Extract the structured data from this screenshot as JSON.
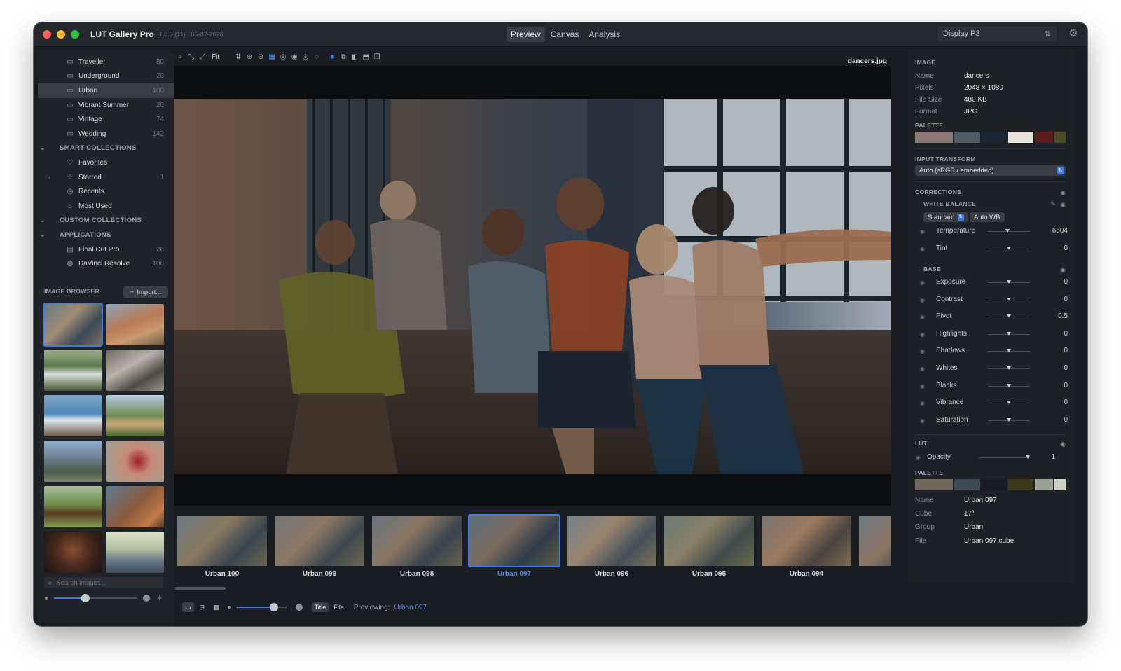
{
  "app": {
    "title": "LUT Gallery Pro",
    "version": "1.0.9 (11) · 05-07-2026"
  },
  "modes": [
    {
      "label": "Preview",
      "active": true
    },
    {
      "label": "Canvas",
      "active": false
    },
    {
      "label": "Analysis",
      "active": false
    }
  ],
  "display": {
    "label": "Display P3"
  },
  "library": {
    "collections": [
      {
        "label": "Traveller",
        "count": "80"
      },
      {
        "label": "Underground",
        "count": "20"
      },
      {
        "label": "Urban",
        "count": "100",
        "selected": true
      },
      {
        "label": "Vibrant Summer",
        "count": "20"
      },
      {
        "label": "Vintage",
        "count": "74"
      },
      {
        "label": "Wedding",
        "count": "142"
      }
    ],
    "smart_head": "SMART COLLECTIONS",
    "smart": [
      {
        "label": "Favorites",
        "count": ""
      },
      {
        "label": "Starred",
        "count": "1"
      },
      {
        "label": "Recents",
        "count": ""
      },
      {
        "label": "Most Used",
        "count": ""
      }
    ],
    "custom_head": "CUSTOM COLLECTIONS",
    "apps_head": "APPLICATIONS",
    "apps": [
      {
        "label": "Final Cut Pro",
        "count": "26"
      },
      {
        "label": "DaVinci Resolve",
        "count": "108"
      }
    ]
  },
  "image_browser": {
    "title": "IMAGE BROWSER",
    "import_label": "Import...",
    "search_placeholder": "Search images..."
  },
  "viewer": {
    "fit_label": "Fit",
    "filename": "dancers.jpg"
  },
  "filmstrip": [
    {
      "label": "Urban 100"
    },
    {
      "label": "Urban 099"
    },
    {
      "label": "Urban 098"
    },
    {
      "label": "Urban 097",
      "selected": true
    },
    {
      "label": "Urban 096"
    },
    {
      "label": "Urban 095"
    },
    {
      "label": "Urban 094"
    },
    {
      "label": "U"
    }
  ],
  "bottombar": {
    "title_btn": "Title",
    "file_btn": "File",
    "previewing_label": "Previewing:",
    "previewing_value": "Urban 097",
    "strip_size_fraction": 0.75
  },
  "browser_size_fraction": 0.38,
  "inspector": {
    "image_head": "IMAGE",
    "image": {
      "name_k": "Name",
      "name_v": "dancers",
      "pixels_k": "Pixels",
      "pixels_v": "2048 × 1080",
      "size_k": "File Size",
      "size_v": "480 KB",
      "format_k": "Format",
      "format_v": "JPG"
    },
    "palette_head": "PALETTE",
    "palette": [
      "#8a7c74",
      "#4f5b66",
      "#1d2636",
      "#e7e3d8",
      "#5a1e1e",
      "#4b4a24"
    ],
    "input_transform_head": "INPUT TRANSFORM",
    "input_transform_value": "Auto (sRGB / embedded)",
    "corrections_head": "CORRECTIONS",
    "wb_head": "WHITE BALANCE",
    "wb_mode": "Standard",
    "wb_auto": "Auto WB",
    "wb_sliders": [
      {
        "label": "Temperature",
        "value": "6504",
        "pos": 0.47
      },
      {
        "label": "Tint",
        "value": "0",
        "pos": 0.5
      }
    ],
    "base_head": "BASE",
    "base_sliders": [
      {
        "label": "Exposure",
        "value": "0",
        "pos": 0.5
      },
      {
        "label": "Contrast",
        "value": "0",
        "pos": 0.5
      },
      {
        "label": "Pivot",
        "value": "0.5",
        "pos": 0.5
      },
      {
        "label": "Highlights",
        "value": "0",
        "pos": 0.5
      },
      {
        "label": "Shadows",
        "value": "0",
        "pos": 0.5
      },
      {
        "label": "Whites",
        "value": "0",
        "pos": 0.5
      },
      {
        "label": "Blacks",
        "value": "0",
        "pos": 0.5
      },
      {
        "label": "Vibrance",
        "value": "0",
        "pos": 0.5
      },
      {
        "label": "Saturation",
        "value": "0",
        "pos": 0.5
      }
    ],
    "lut_head": "LUT",
    "opacity_label": "Opacity",
    "opacity_value": "1",
    "opacity_pos": 1.0,
    "lut_palette_head": "PALETTE",
    "lut_palette": [
      "#6f665c",
      "#3e4a54",
      "#171c26",
      "#3b3a1f",
      "#9c9f94",
      "#cdd0c3"
    ],
    "lut_info": {
      "name_k": "Name",
      "name_v": "Urban 097",
      "cube_k": "Cube",
      "cube_v": "17³",
      "group_k": "Group",
      "group_v": "Urban",
      "file_k": "File",
      "file_v": "Urban 097.cube"
    }
  },
  "colors": {
    "accent": "#3f7be6",
    "window_bg": "#1a1d21",
    "panel_bg": "#1e2125"
  }
}
